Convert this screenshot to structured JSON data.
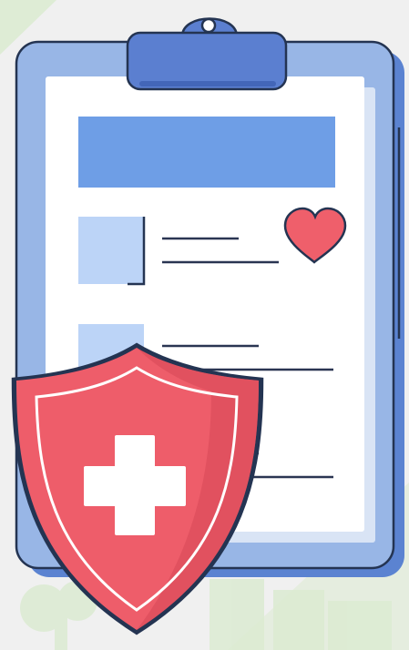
{
  "illustration": {
    "subject": "medical-clipboard-with-shield",
    "colors": {
      "background": "#f0f0f0",
      "bg_accent_green": "#dcebd2",
      "clipboard_board": "#98b6e6",
      "clipboard_board_shadow": "#5b83d1",
      "clip": "#5b7fd0",
      "outline": "#243452",
      "paper": "#ffffff",
      "paper_shadow": "#d9e4f5",
      "header_bar": "#6e9ee6",
      "thumbnail": "#bcd4f7",
      "text_line": "#2a3552",
      "heart": "#ef5f6b",
      "shield": "#ee5d6a",
      "shield_shade": "#d84a58",
      "shield_inner_line": "#ffffff",
      "cross": "#ffffff"
    },
    "icons": [
      "clipboard-icon",
      "clip-icon",
      "heart-icon",
      "shield-icon",
      "medical-cross-icon",
      "building-silhouette-icon"
    ]
  }
}
